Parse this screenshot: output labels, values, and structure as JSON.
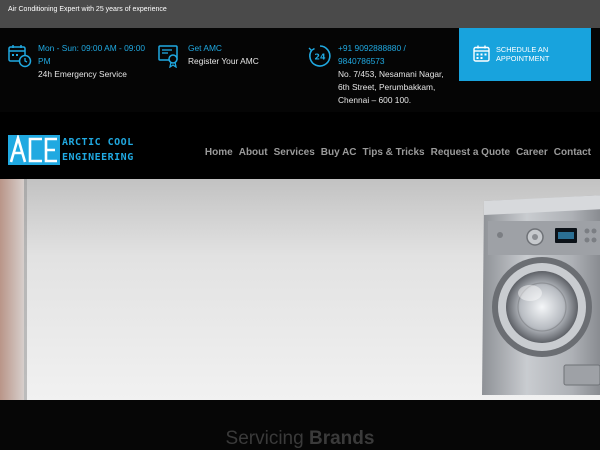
{
  "topbar": {
    "tagline": "Air Conditioning Expert with 25 years of experience"
  },
  "info": {
    "hours": {
      "line1": "Mon - Sun: 09:00 AM - 09:00 PM",
      "line2": "24h Emergency Service",
      "icon": "calendar-clock-icon"
    },
    "amc": {
      "line1": "Get AMC",
      "line2": "Register Your AMC",
      "icon": "certificate-icon"
    },
    "phone": {
      "line1": "+91 9092888880 / 9840786573",
      "line2": "No. 7/453, Nesamani Nagar, 6th Street, Perumbakkam, Chennai – 600 100.",
      "icon": "24h-phone-icon"
    }
  },
  "cta": {
    "label": "SCHEDULE AN APPOINTMENT",
    "icon": "calendar-icon"
  },
  "logo": {
    "mark": "ACE",
    "line1": "ARCTIC COOL",
    "line2": "ENGINEERING"
  },
  "nav": [
    "Home",
    "About",
    "Services",
    "Buy AC",
    "Tips & Tricks",
    "Request a Quote",
    "Career",
    "Contact"
  ],
  "brands": {
    "light": "Servicing ",
    "bold": "Brands"
  },
  "colors": {
    "accent": "#20a9e1",
    "cta_bg": "#18a3dd",
    "topbar_bg": "#4a4a4a"
  }
}
